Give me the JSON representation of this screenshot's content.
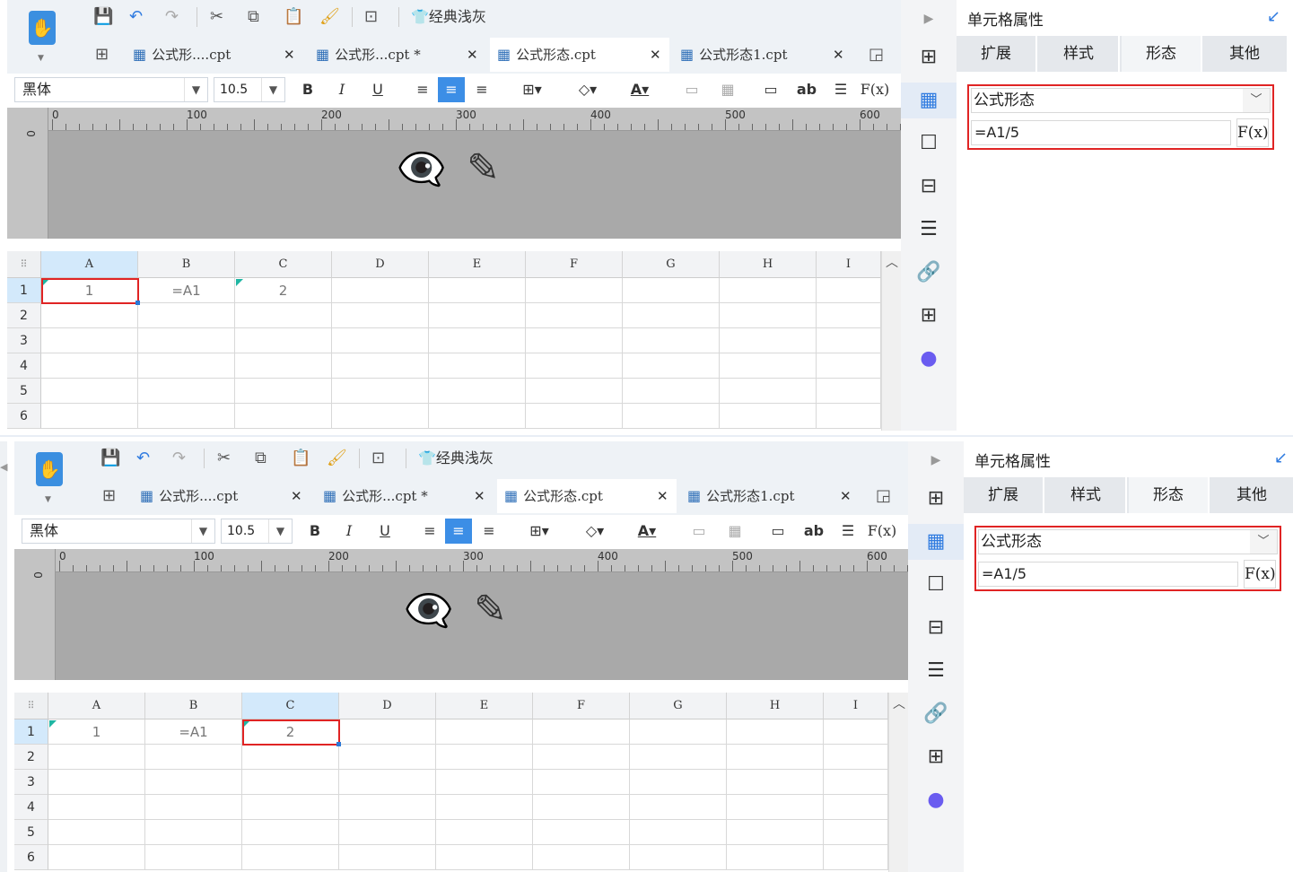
{
  "skin_label": "经典浅灰",
  "tabs": [
    {
      "label": "公式形....cpt"
    },
    {
      "label": "公式形...cpt *"
    },
    {
      "label": "公式形态.cpt"
    },
    {
      "label": "公式形态1.cpt"
    }
  ],
  "tab_close": "✕",
  "font_name": "黑体",
  "font_size": "10.5",
  "format": {
    "bold": "B",
    "italic": "I",
    "underline": "U",
    "ab": "ab",
    "fx": "F(x)"
  },
  "ruler": {
    "labels": [
      "0",
      "100",
      "200",
      "300",
      "400",
      "500",
      "600"
    ],
    "vzero": "0"
  },
  "grid": {
    "columns": [
      "A",
      "B",
      "C",
      "D",
      "E",
      "F",
      "G",
      "H",
      "I"
    ],
    "rows": [
      "1",
      "2",
      "3",
      "4",
      "5",
      "6"
    ],
    "cells": [
      "1",
      "=A1",
      "2"
    ]
  },
  "property_panel": {
    "title": "单元格属性",
    "tabs": [
      "扩展",
      "样式",
      "形态",
      "其他"
    ],
    "form_type": "公式形态",
    "formula": "=A1/5",
    "fx_label": "F(x)"
  },
  "panels": [
    {
      "selected_cell": "A1",
      "selected_col": "A"
    },
    {
      "selected_cell": "C1",
      "selected_col": "C"
    }
  ]
}
